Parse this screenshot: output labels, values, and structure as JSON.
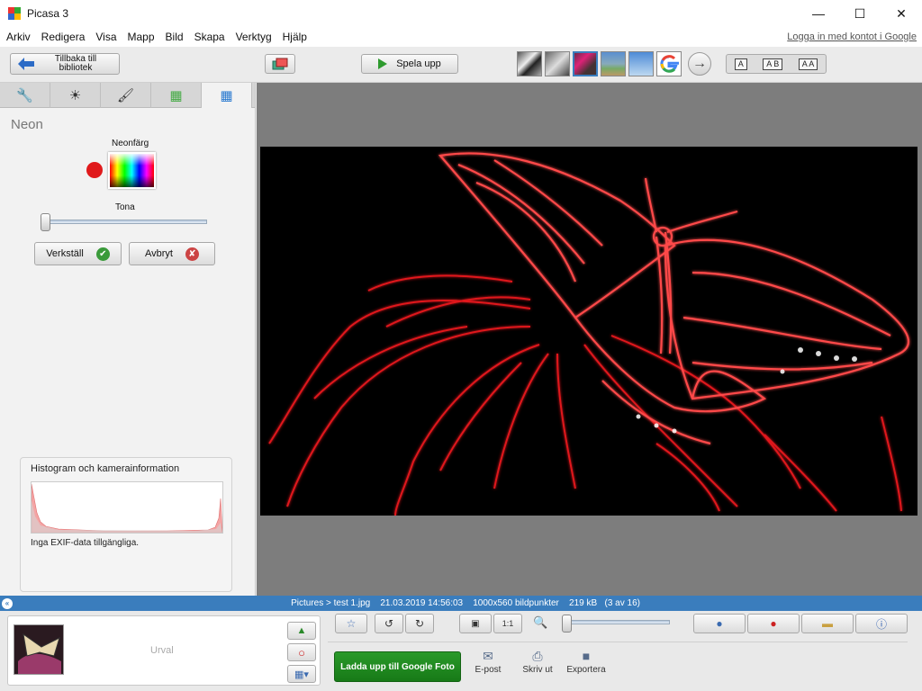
{
  "window": {
    "title": "Picasa 3",
    "controls": [
      "—",
      "☐",
      "✕"
    ]
  },
  "menu": {
    "items": [
      "Arkiv",
      "Redigera",
      "Visa",
      "Mapp",
      "Bild",
      "Skapa",
      "Verktyg",
      "Hjälp"
    ],
    "login_link": "Logga in med kontot i Google"
  },
  "toolbar": {
    "back_label": "Tillbaka till bibliotek",
    "play_label": "Spela upp",
    "view_modes": [
      "A",
      "A B",
      "A A"
    ]
  },
  "edit_panel": {
    "title": "Neon",
    "neon_color_label": "Neonfärg",
    "neon_color": "#e0191b",
    "tone_label": "Tona",
    "tone_value": 0,
    "apply_label": "Verkställ",
    "cancel_label": "Avbryt"
  },
  "histogram": {
    "title": "Histogram och kamerainformation",
    "exif_text": "Inga EXIF-data tillgängliga."
  },
  "status": {
    "path": "Pictures > test 1.jpg",
    "datetime": "21.03.2019 14:56:03",
    "dimensions": "1000x560 bildpunkter",
    "size": "219 kB",
    "position": "(3 av 16)"
  },
  "tray": {
    "label": "Urval"
  },
  "bottom_actions": {
    "upload_label": "Ladda upp till Google Foto",
    "email_label": "E-post",
    "print_label": "Skriv ut",
    "export_label": "Exportera"
  },
  "colors": {
    "accent_blue": "#3a7dbd",
    "upload_green": "#1f8a1f",
    "neon_red": "#e0191b"
  }
}
